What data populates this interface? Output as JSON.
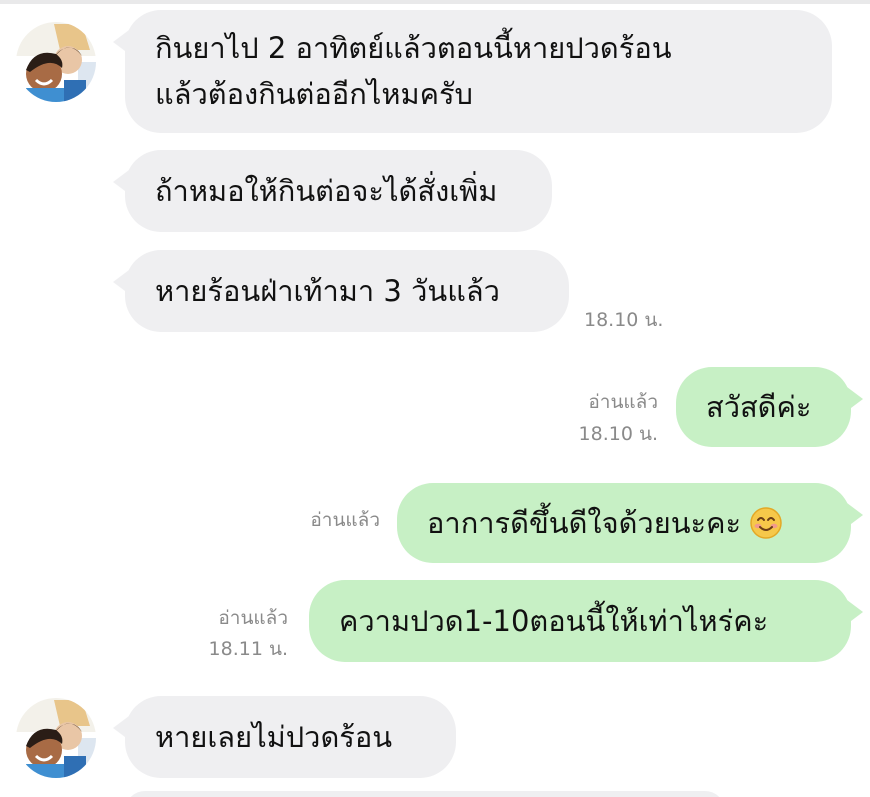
{
  "messages": {
    "m1": {
      "line1": "กินยาไป 2 อาทิตย์แล้วตอนนี้หายปวดร้อน",
      "line2": "แล้วต้องกินต่ออีกไหมครับ"
    },
    "m2": {
      "text": "ถ้าหมอให้กินต่อจะได้สั่งเพิ่ม"
    },
    "m3": {
      "text": "หายร้อนฝ่าเท้ามา 3 วันแล้ว",
      "time": "18.10 น."
    },
    "m4": {
      "text": "สวัสดีค่ะ",
      "read": "อ่านแล้ว",
      "time": "18.10 น."
    },
    "m5": {
      "text": "อาการดีขึ้นดีใจด้วยนะคะ",
      "read": "อ่านแล้ว"
    },
    "m6": {
      "text": "ความปวด1-10ตอนนี้ให้เท่าไหร่คะ",
      "read": "อ่านแล้ว",
      "time": "18.11 น."
    },
    "m7": {
      "text": "หายเลยไม่ปวดร้อน"
    }
  },
  "icons": {
    "avatar": "contact-avatar",
    "emoji": "smiling-face-emoji"
  },
  "colors": {
    "incoming_bubble": "#efeff1",
    "outgoing_bubble": "#c7f0c5",
    "meta_text": "#8a8a8a"
  }
}
